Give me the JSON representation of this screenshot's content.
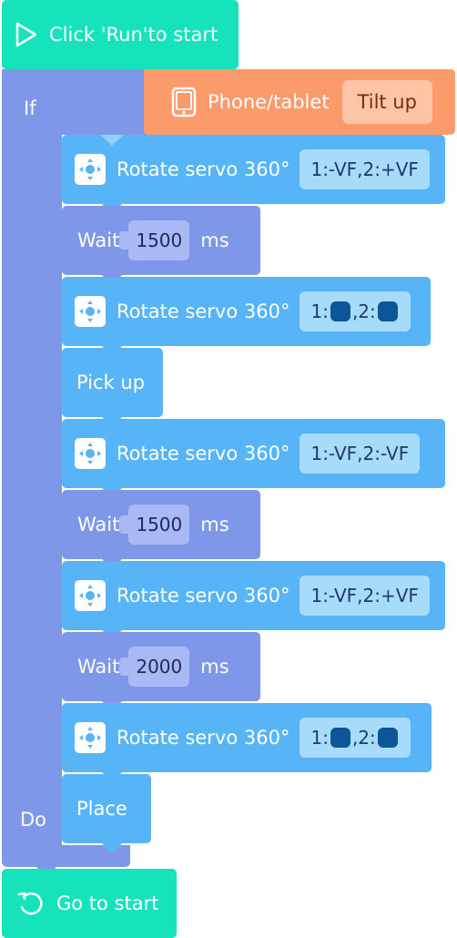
{
  "start_block": {
    "label": "Click 'Run'to start",
    "icon": "play-icon"
  },
  "if_block": {
    "if_label": "If",
    "do_label": "Do",
    "condition": {
      "source": "Phone/tablet",
      "value": "Tilt up",
      "icon": "tablet-icon"
    }
  },
  "steps": [
    {
      "type": "servo",
      "label": "Rotate servo 360°",
      "param": "1:-VF,2:+VF"
    },
    {
      "type": "wait",
      "label": "Wait",
      "value": "1500",
      "unit": "ms"
    },
    {
      "type": "servo",
      "label": "Rotate servo 360°",
      "param_parts": [
        "1:",
        ",2:"
      ]
    },
    {
      "type": "action",
      "label": "Pick up"
    },
    {
      "type": "servo",
      "label": "Rotate servo 360°",
      "param": "1:-VF,2:-VF"
    },
    {
      "type": "wait",
      "label": "Wait",
      "value": "1500",
      "unit": "ms"
    },
    {
      "type": "servo",
      "label": "Rotate servo 360°",
      "param": "1:-VF,2:+VF"
    },
    {
      "type": "wait",
      "label": "Wait",
      "value": "2000",
      "unit": "ms"
    },
    {
      "type": "servo",
      "label": "Rotate servo 360°",
      "param_parts": [
        "1:",
        ",2:"
      ]
    },
    {
      "type": "action",
      "label": "Place"
    }
  ],
  "end_block": {
    "label": "Go to start",
    "icon": "loop-icon"
  },
  "colors": {
    "start_end": "#16e3bb",
    "servo": "#56b4f7",
    "wait": "#7f97e9",
    "condition": "#fb9a6b",
    "if_frame": "#7f97e9"
  }
}
